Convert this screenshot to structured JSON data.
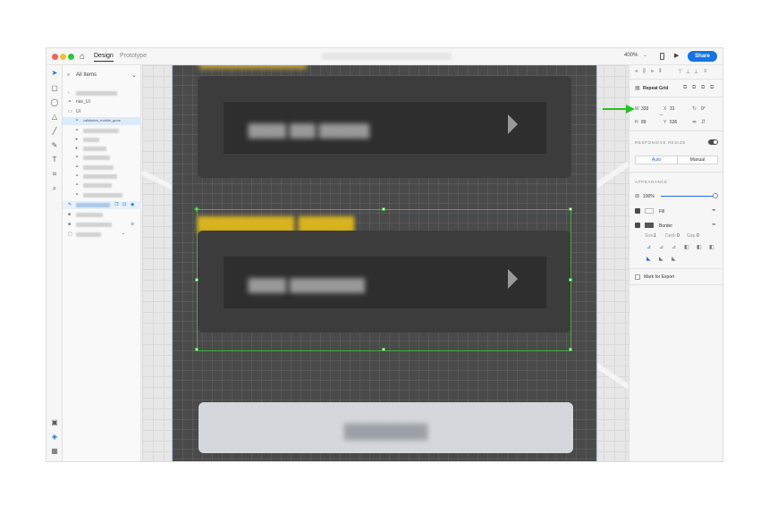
{
  "titlebar": {
    "home_icon": "home-icon",
    "tab_design": "Design",
    "tab_prototype": "Prototype",
    "zoom": "400%",
    "share": "Share",
    "colors": {
      "close": "#fe5f57",
      "minimize": "#febc2e",
      "maximize": "#28c840",
      "accent": "#1473e6"
    }
  },
  "layers": {
    "filter_label": "All Items",
    "rows": [
      {
        "label": "nav_UI"
      },
      {
        "label": "UI"
      },
      {
        "label": "validation_mobile_gene"
      }
    ]
  },
  "props": {
    "repeat_grid": "Repeat Grid",
    "w_label": "W",
    "w_value": "333",
    "x_label": "X",
    "x_value": "31",
    "rotation": "0°",
    "h_label": "H",
    "h_value": "89",
    "y_label": "Y",
    "y_value": "536",
    "responsive_resize": "RESPONSIVE RESIZE",
    "auto": "Auto",
    "manual": "Manual",
    "appearance": "APPEARANCE",
    "opacity": "100%",
    "fill": "Fill",
    "border": "Border",
    "size_label": "Size",
    "size_value": "1",
    "dash_label": "Dash",
    "dash_value": "0",
    "gap_label": "Gap",
    "gap_value": "0",
    "mark_for_export": "Mark for Export"
  }
}
